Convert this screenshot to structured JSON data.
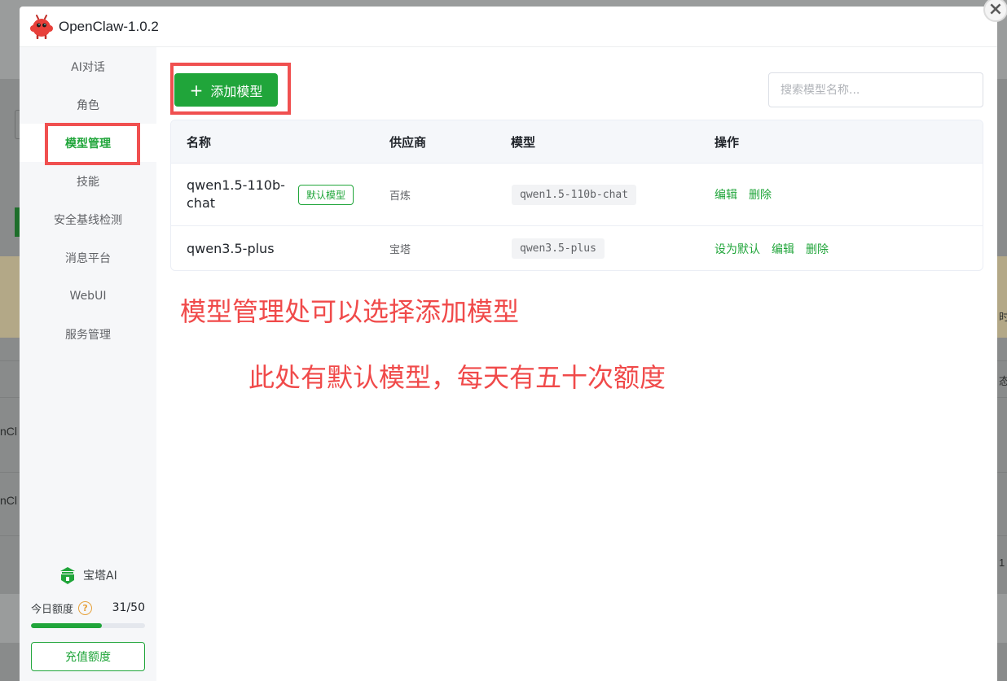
{
  "app": {
    "title": "OpenClaw-1.0.2"
  },
  "sidebar": {
    "items": [
      {
        "label": "AI对话",
        "active": false
      },
      {
        "label": "角色",
        "active": false
      },
      {
        "label": "模型管理",
        "active": true
      },
      {
        "label": "技能",
        "active": false
      },
      {
        "label": "安全基线检测",
        "active": false
      },
      {
        "label": "消息平台",
        "active": false
      },
      {
        "label": "WebUI",
        "active": false
      },
      {
        "label": "服务管理",
        "active": false
      }
    ],
    "brand_label": "宝塔AI",
    "quota_label": "今日额度",
    "quota_help": "?",
    "quota_value": "31/50",
    "quota_fraction": 0.62,
    "recharge_label": "充值额度"
  },
  "toolbar": {
    "add_plus": "+",
    "add_label": "添加模型",
    "search_placeholder": "搜索模型名称..."
  },
  "table": {
    "headers": [
      "名称",
      "供应商",
      "模型",
      "操作"
    ],
    "rows": [
      {
        "name": "qwen1.5-110b-chat",
        "tag": "默认模型",
        "provider": "百炼",
        "model": "qwen1.5-110b-chat",
        "actions": [
          "编辑",
          "删除"
        ]
      },
      {
        "name": "qwen3.5-plus",
        "tag": "",
        "provider": "宝塔",
        "model": "qwen3.5-plus",
        "actions": [
          "设为默认",
          "编辑",
          "删除"
        ]
      }
    ]
  },
  "annotations": {
    "line1": "模型管理处可以选择添加模型",
    "line2": "此处有默认模型，每天有五十次额度"
  },
  "background": {
    "left_text_1": "nCl",
    "left_text_2": "nCl",
    "right_text_1": "时",
    "right_text_2": "态",
    "right_text_3": "1"
  },
  "colors": {
    "accent": "#20a53a",
    "annotation_red": "#f04a4a",
    "highlight_box": "#f05050"
  },
  "icons": {
    "app_logo": "red-mascot-icon",
    "brand": "baota-logo-icon",
    "close": "close-icon",
    "help": "question-icon",
    "add": "plus-icon"
  }
}
